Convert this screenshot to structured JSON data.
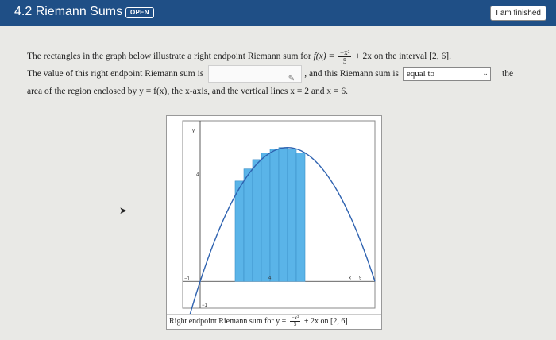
{
  "header": {
    "title": "4.2 Riemann Sums",
    "badge": "OPEN",
    "finish_button": "I am finished"
  },
  "question": {
    "line1_text": "The rectangles in the graph below illustrate a right endpoint Riemann sum for ",
    "func_lhs": "f(x) = ",
    "frac_num": "−x²",
    "frac_den": "5",
    "func_rhs": " + 2x on the interval [2, 6].",
    "line2_a": "The value of this right endpoint Riemann sum is",
    "line2_b": ", and this Riemann sum is",
    "answer_value": "",
    "select_value": "equal to",
    "line2_c": "the",
    "line3": "area of the region enclosed by y = f(x), the x-axis, and the vertical lines x = 2 and x = 6."
  },
  "graph": {
    "caption_a": "Right endpoint Riemann sum for y = ",
    "caption_frac_num": "−x²",
    "caption_frac_den": "5",
    "caption_b": " + 2x on [2, 6]",
    "tick_labels": {
      "y_axis": "y",
      "y_4": "4",
      "x_neg1": "−1",
      "x_4": "4",
      "x_x": "x",
      "x_9": "9",
      "y_neg1": "−1"
    },
    "chart_data": {
      "type": "bar",
      "function": "-x^2/5 + 2x",
      "interval": [
        2,
        6
      ],
      "subintervals": 8,
      "right_endpoints": [
        2.5,
        3,
        3.5,
        4,
        4.5,
        5,
        5.5,
        6
      ],
      "heights": [
        3.75,
        4.2,
        4.55,
        4.8,
        4.95,
        5,
        4.95,
        4.8
      ],
      "xlim": [
        -1,
        10
      ],
      "ylim": [
        -1,
        6
      ],
      "bar_color": "#5ab4e8",
      "curve_color": "#2e62b0"
    }
  }
}
